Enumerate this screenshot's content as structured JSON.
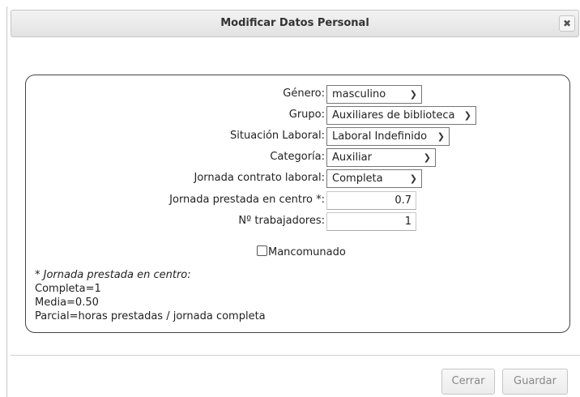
{
  "dialog": {
    "title": "Modificar Datos Personal",
    "close_icon": "close-icon"
  },
  "form": {
    "fields": [
      {
        "label": "Género:",
        "value": "masculino"
      },
      {
        "label": "Grupo:",
        "value": "Auxiliares de biblioteca"
      },
      {
        "label": "Situación Laboral:",
        "value": "Laboral Indefinido"
      },
      {
        "label": "Categoría:",
        "value": "Auxiliar"
      },
      {
        "label": "Jornada contrato laboral:",
        "value": "Completa"
      },
      {
        "label": "Jornada prestada en centro *:",
        "value": "0.7"
      },
      {
        "label": "Nº trabajadores:",
        "value": "1"
      }
    ],
    "mancomunado_label": "Mancomunado",
    "note": {
      "heading": "* Jornada prestada en centro:",
      "line1": "Completa=1",
      "line2": "Media=0.50",
      "line3": "Parcial=horas prestadas / jornada completa"
    }
  },
  "footer": {
    "close_label": "Cerrar",
    "save_label": "Guardar"
  }
}
